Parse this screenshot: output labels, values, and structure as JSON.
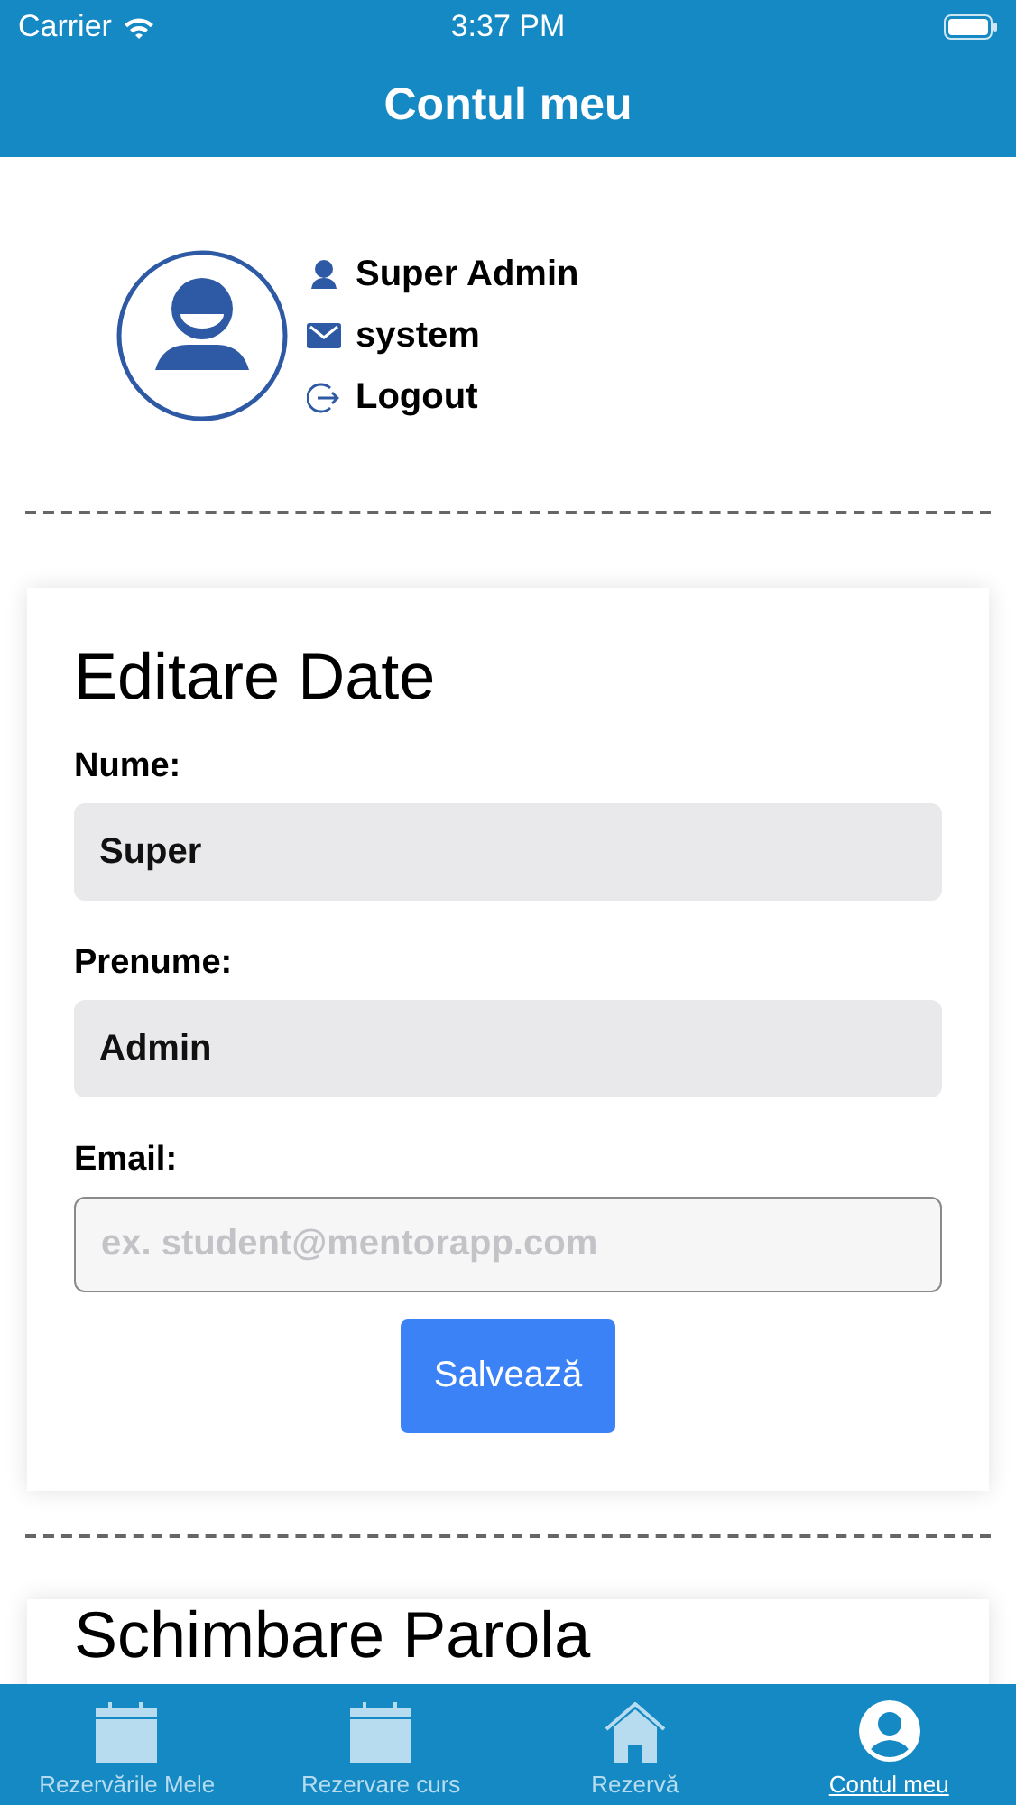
{
  "status_bar": {
    "carrier": "Carrier",
    "time": "3:37 PM"
  },
  "header": {
    "title": "Contul meu"
  },
  "profile": {
    "name": "Super Admin",
    "email": "system",
    "logout": "Logout"
  },
  "edit_card": {
    "title": "Editare Date",
    "fields": [
      {
        "label": "Nume:",
        "value": "Super",
        "kind": "filled"
      },
      {
        "label": "Prenume:",
        "value": "Admin",
        "kind": "filled"
      },
      {
        "label": "Email:",
        "placeholder": "ex. student@mentorapp.com",
        "kind": "input"
      }
    ],
    "button": "Salvează"
  },
  "password_card": {
    "title": "Schimbare Parola"
  },
  "tabs": [
    {
      "label": "Rezervările Mele",
      "kind": "calendar",
      "selected": false
    },
    {
      "label": "Rezervare curs",
      "kind": "calendar",
      "selected": false
    },
    {
      "label": "Rezervă",
      "kind": "home",
      "selected": false
    },
    {
      "label": "Contul meu",
      "kind": "user",
      "selected": true
    }
  ]
}
